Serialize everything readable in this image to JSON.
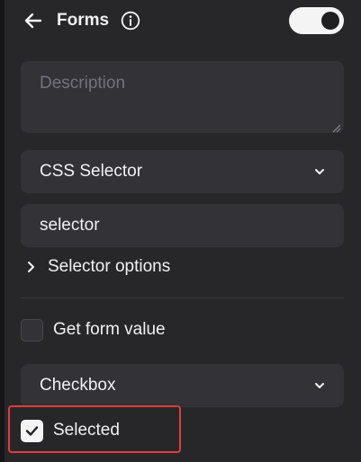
{
  "header": {
    "title": "Forms",
    "toggle_on": true
  },
  "description": {
    "placeholder": "Description"
  },
  "selector_type": {
    "selected": "CSS Selector"
  },
  "selector_input": {
    "value": "selector"
  },
  "selector_options": {
    "label": "Selector options"
  },
  "get_form_value": {
    "label": "Get form value",
    "checked": false
  },
  "form_type": {
    "selected": "Checkbox"
  },
  "selected_option": {
    "label": "Selected",
    "checked": true
  },
  "colors": {
    "background": "#27272a",
    "field": "#333337",
    "text": "#f1f1f3",
    "placeholder": "#72727a",
    "highlight": "#e23c3c"
  },
  "icons": [
    "arrow-left-icon",
    "info-icon",
    "chevron-down-icon",
    "chevron-right-icon",
    "check-icon",
    "resize-grip-icon"
  ]
}
